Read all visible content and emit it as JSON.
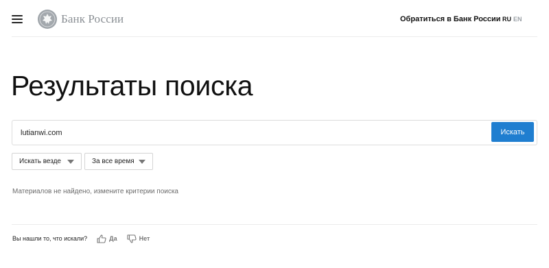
{
  "header": {
    "logo_text": "Банк России",
    "contact_link": "Обратиться в Банк России",
    "languages": {
      "ru": "RU",
      "en": "EN"
    }
  },
  "main": {
    "title": "Результаты поиска",
    "search": {
      "value": "lutianwi.com",
      "button_label": "Искать"
    },
    "filters": {
      "where": "Искать везде",
      "time": "За все время"
    },
    "no_results_text": "Материалов не найдено, измените критерии поиска"
  },
  "feedback": {
    "question": "Вы нашли то, что искали?",
    "yes": "Да",
    "no": "Нет"
  },
  "colors": {
    "accent": "#1f7ed0",
    "muted_text": "#6b6b6b",
    "logo_gray": "#8a8f94"
  },
  "icons": {
    "menu": "hamburger-icon",
    "logo": "bank-emblem-icon",
    "dropdown": "caret-down-icon",
    "yes": "thumbs-up-icon",
    "no": "thumbs-down-icon"
  }
}
